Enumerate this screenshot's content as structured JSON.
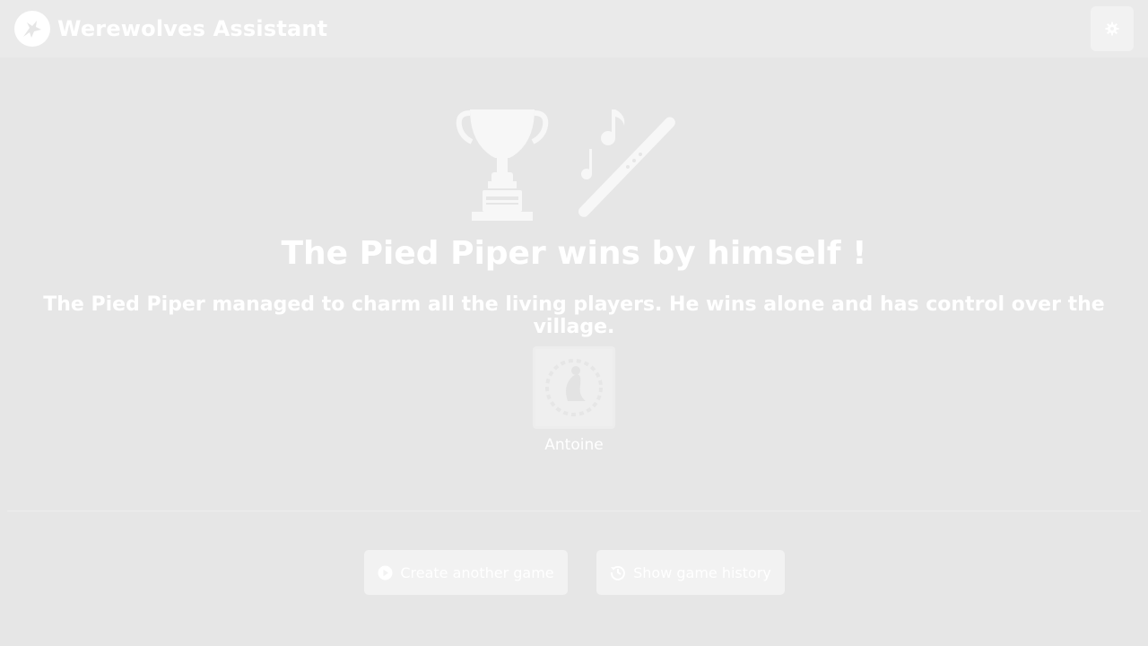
{
  "app": {
    "title": "Werewolves Assistant",
    "logo_icon": "werewolf-logo-icon",
    "settings_icon": "gear-icon"
  },
  "result": {
    "icons": [
      "trophy-icon",
      "flute-music-icon"
    ],
    "title": "The Pied Piper wins by himself !",
    "description": "The Pied Piper managed to charm all the living players. He wins alone and has control over the village.",
    "winners": [
      {
        "name": "Antoine",
        "role_icon": "pied-piper-card-icon"
      }
    ]
  },
  "actions": {
    "create_game": {
      "label": "Create another game",
      "icon": "play-circle-icon"
    },
    "show_history": {
      "label": "Show game history",
      "icon": "history-icon"
    }
  },
  "colors": {
    "background": "#e6e6e6",
    "navbar": "#eaeaea",
    "button": "#f2f2f2",
    "text": "#ffffff"
  }
}
